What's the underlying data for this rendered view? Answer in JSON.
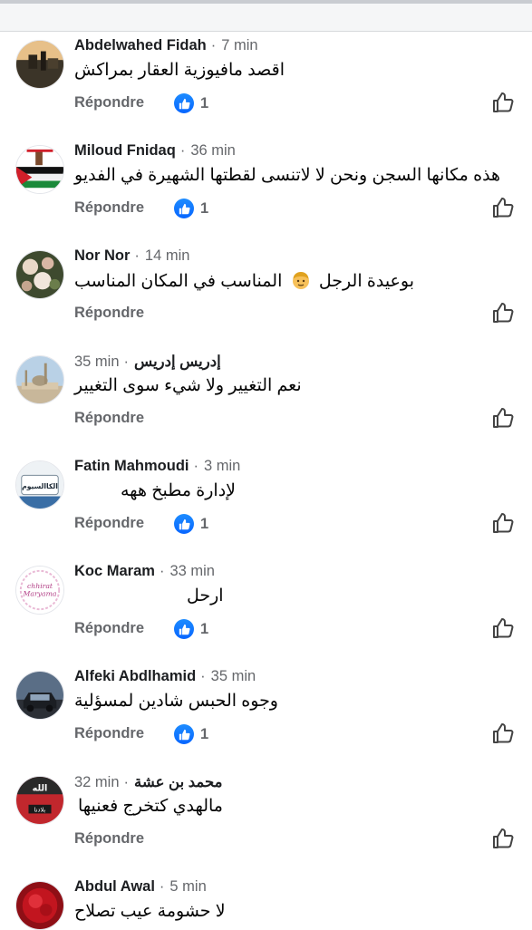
{
  "reply_label": "Répondre",
  "comments": [
    {
      "name": "Abdelwahed Fidah",
      "time": "7 min",
      "text": "اقصد مافيوزية العقار بمراكش",
      "likes": "1"
    },
    {
      "name": "Miloud Fnidaq",
      "time": "36 min",
      "text": "هذه مكانها السجن ونحن لا لاتنسى لقطتها الشهيرة في الفديو",
      "likes": "1"
    },
    {
      "name": "Nor Nor",
      "time": "14 min",
      "text_before": "بوعيدة الرجل",
      "text_after": "المناسب في المكان المناسب",
      "emoji": "man-emoji",
      "likes": ""
    },
    {
      "name": "إدريس إدريس",
      "time": "35 min",
      "text": "نعم التغيير ولا شيء سوى التغيير",
      "likes": ""
    },
    {
      "name": "Fatin Mahmoudi",
      "time": "3 min",
      "text": "لإدارة مطبخ ههه",
      "likes": "1"
    },
    {
      "name": "Koc Maram",
      "time": "33 min",
      "text": "ارحل",
      "likes": "1"
    },
    {
      "name": "Alfeki Abdlhamid",
      "time": "35 min",
      "text": "وجوه الحبس شادين لمسؤلية",
      "likes": "1"
    },
    {
      "name": "محمد بن عشة",
      "time": "32 min",
      "text": "مالهدي كتخرج فعنيها",
      "likes": ""
    },
    {
      "name": "Abdul Awal",
      "time": "5 min",
      "text": "لا حشومة عيب تصلاح",
      "likes": ""
    }
  ],
  "avatar_texts": {
    "fatin": "الكاالسيوم",
    "koc_line1": "chhirat",
    "koc_line2": "Maryama",
    "mohamed_line1": "الله",
    "mohamed_line2": "بلادنا"
  },
  "colors": {
    "like_blue": "#0866ff",
    "meta_gray": "#65676b",
    "text_dark": "#050505"
  }
}
